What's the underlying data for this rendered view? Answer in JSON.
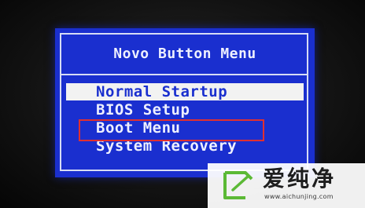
{
  "menu": {
    "title": "Novo Button Menu",
    "items": [
      {
        "label": "Normal Startup",
        "selected": true
      },
      {
        "label": "BIOS Setup",
        "selected": false
      },
      {
        "label": "Boot Menu",
        "selected": false,
        "annotated": true
      },
      {
        "label": "System Recovery",
        "selected": false
      }
    ]
  },
  "watermark": {
    "name": "爱纯净",
    "url": "www.aichunjing.com",
    "icon": "aichunjing-logo-icon"
  },
  "colors": {
    "menu_background": "#1a2fcf",
    "menu_text": "#eef0ff",
    "selection_background": "#f2f2f2",
    "annotation_box": "#e03030",
    "logo_green": "#5bb935"
  }
}
